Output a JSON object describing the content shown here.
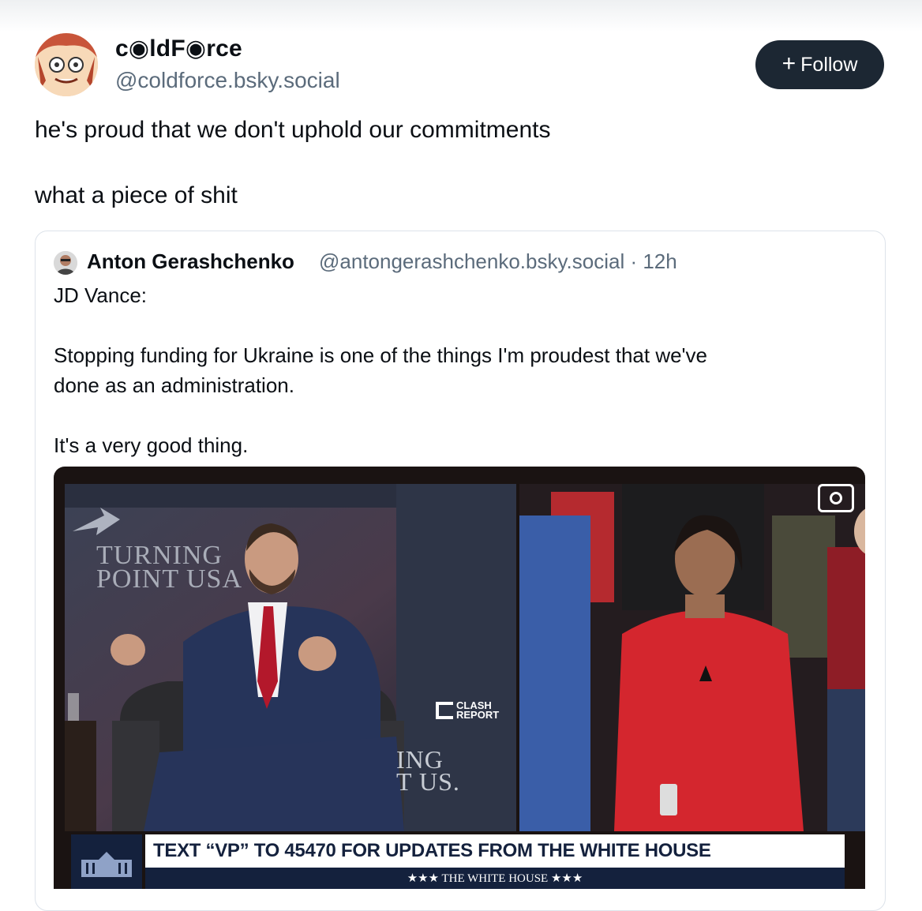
{
  "post": {
    "author": {
      "display_name": "c◉ldF◉rce",
      "handle": "@coldforce.bsky.social"
    },
    "follow_label": "Follow",
    "text_lines": [
      "he's proud that we don't uphold our commitments",
      "what a piece of shit"
    ]
  },
  "quote": {
    "author": {
      "name": "Anton Gerashchenko",
      "handle_time": "@antongerashchenko.bsky.social · 12h"
    },
    "text_lines": [
      "JD Vance:",
      "Stopping funding for Ukraine is one of the things I'm proudest that we've",
      "done as an administration.",
      "It's a very good thing."
    ],
    "media": {
      "left_backdrop_text": [
        "TURNING",
        "POINT USA"
      ],
      "right_backdrop_text": [
        "ING",
        "T US."
      ],
      "watermark": [
        "CLASH",
        "REPORT"
      ],
      "chyron_main": "TEXT “VP” TO 45470 FOR UPDATES FROM THE WHITE HOUSE",
      "chyron_sub": "★★★   THE WHITE HOUSE   ★★★",
      "icons": [
        "camera-icon"
      ],
      "colors": {
        "chyron_navy": "#14213d",
        "tie_red": "#b3182b",
        "jacket_red": "#d4262e"
      }
    }
  }
}
